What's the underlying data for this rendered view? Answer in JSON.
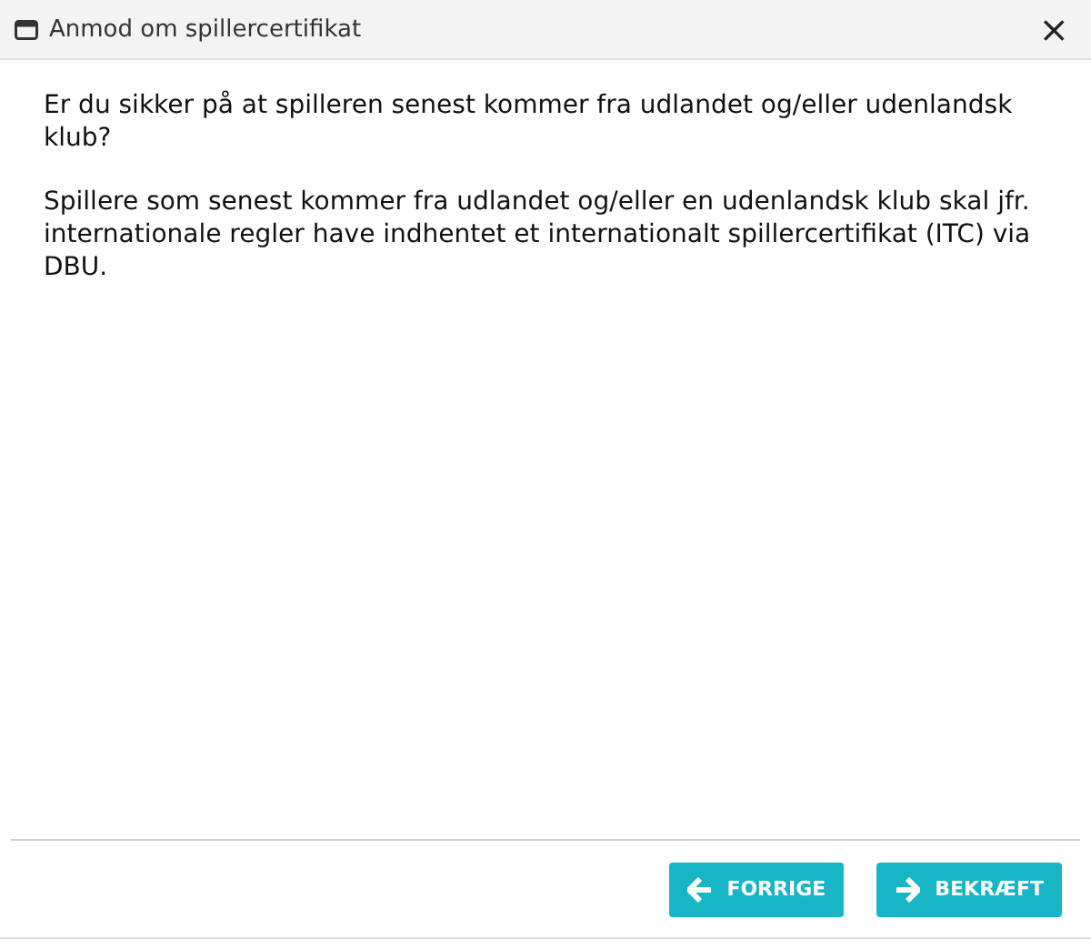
{
  "window": {
    "title": "Anmod om spillercertifikat",
    "close": "×"
  },
  "paragraphs": [
    "Er du sikker på at spilleren senest kommer fra udlandet og/eller udenlandsk klub?",
    "Spillere som senest kommer fra udlandet og/eller en udenlandsk klub skal jfr. internationale regler have indhentet et internationalt spillercertifikat (ITC) via DBU."
  ],
  "buttons": [
    {
      "label": "FORRIGE",
      "kind": "back"
    },
    {
      "label": "BEKRÆFT",
      "kind": "forward"
    }
  ]
}
